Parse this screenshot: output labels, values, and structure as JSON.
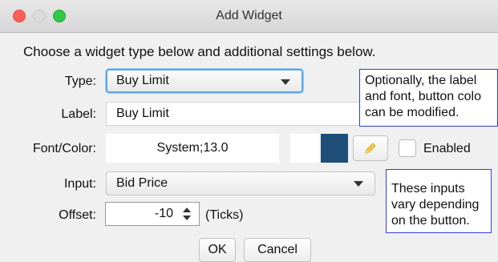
{
  "window": {
    "title": "Add Widget"
  },
  "instructions": "Choose a widget type below and additional settings below.",
  "form": {
    "type_label": "Type:",
    "type_value": "Buy Limit",
    "label_label": "Label:",
    "label_value": "Buy Limit",
    "fontcolor_label": "Font/Color:",
    "font_value": "System;13.0",
    "colors": {
      "background_swatch": "#ffffff",
      "color_swatch": "#1f4e79"
    },
    "edit_icon": "pencil-icon",
    "enabled_label": "Enabled",
    "enabled_checked": false,
    "input_label": "Input:",
    "input_value": "Bid Price",
    "offset_label": "Offset:",
    "offset_value": "-10",
    "offset_unit": "(Ticks)"
  },
  "buttons": {
    "ok": "OK",
    "cancel": "Cancel"
  },
  "tooltips": {
    "label_tip": "Optionally, the label\nand font, button colo\ncan be modified.",
    "input_tip": "These inputs\nvary depending\non the button."
  }
}
